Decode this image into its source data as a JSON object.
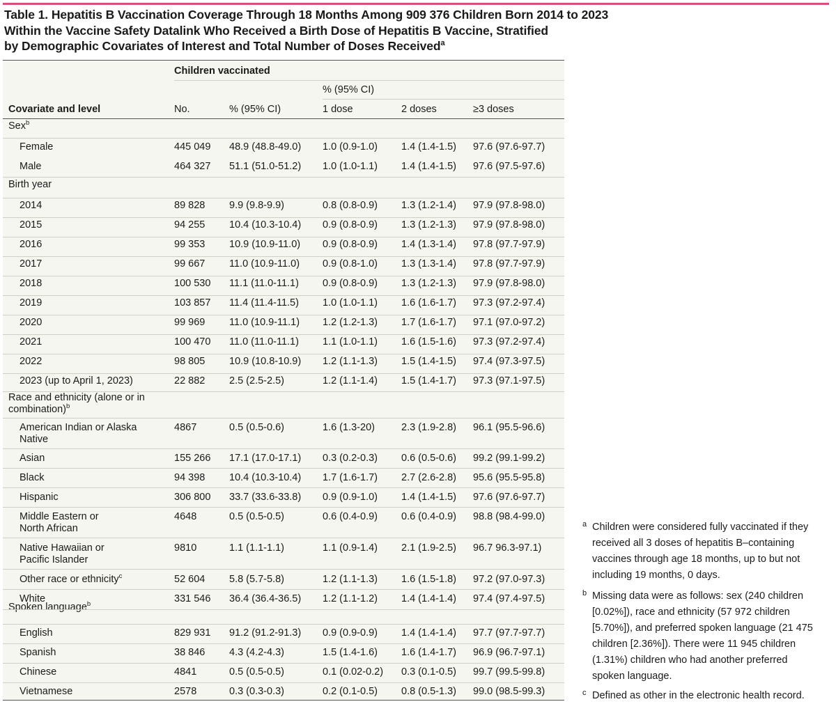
{
  "title": {
    "line1": "Table 1. Hepatitis B Vaccination Coverage Through 18 Months Among 909 376 Children Born 2014 to 2023",
    "line2": "Within the Vaccine Safety Datalink Who Received a Birth Dose of Hepatitis B Vaccine, Stratified",
    "line3": "by Demographic Covariates of Interest and Total Number of Doses Received",
    "line3_sup": "a"
  },
  "header": {
    "children_vaccinated": "Children vaccinated",
    "pct_ci_group": "% (95% CI)",
    "col_covariate": "Covariate and level",
    "col_no": "No.",
    "col_pct": "% (95% CI)",
    "col_1dose": "1 dose",
    "col_2doses": "2 doses",
    "col_3doses": "≥3 doses"
  },
  "sections": {
    "sex": {
      "label": "Sex",
      "sup": "b"
    },
    "birth_year": {
      "label": "Birth year"
    },
    "race": {
      "label1": "Race and ethnicity (alone or in",
      "label2": "combination)",
      "sup": "b"
    },
    "language": {
      "label": "Spoken language",
      "sup": "b"
    }
  },
  "rows": [
    {
      "label": "Female",
      "no": "445 049",
      "pct": "48.9 (48.8-49.0)",
      "d1": "1.0 (0.9-1.0)",
      "d2": "1.4 (1.4-1.5)",
      "d3": "97.6 (97.6-97.7)"
    },
    {
      "label": "Male",
      "no": "464 327",
      "pct": "51.1 (51.0-51.2)",
      "d1": "1.0 (1.0-1.1)",
      "d2": "1.4 (1.4-1.5)",
      "d3": "97.6 (97.5-97.6)"
    },
    {
      "label": "2014",
      "no": "89 828",
      "pct": "9.9 (9.8-9.9)",
      "d1": "0.8 (0.8-0.9)",
      "d2": "1.3 (1.2-1.4)",
      "d3": "97.9 (97.8-98.0)"
    },
    {
      "label": "2015",
      "no": "94 255",
      "pct": "10.4 (10.3-10.4)",
      "d1": "0.9 (0.8-0.9)",
      "d2": "1.3 (1.2-1.3)",
      "d3": "97.9 (97.8-98.0)"
    },
    {
      "label": "2016",
      "no": "99 353",
      "pct": "10.9 (10.9-11.0)",
      "d1": "0.9 (0.8-0.9)",
      "d2": "1.4 (1.3-1.4)",
      "d3": "97.8 (97.7-97.9)"
    },
    {
      "label": "2017",
      "no": "99 667",
      "pct": "11.0 (10.9-11.0)",
      "d1": "0.9 (0.8-1.0)",
      "d2": "1.3 (1.3-1.4)",
      "d3": "97.8 (97.7-97.9)"
    },
    {
      "label": "2018",
      "no": "100 530",
      "pct": "11.1 (11.0-11.1)",
      "d1": "0.9 (0.8-0.9)",
      "d2": "1.3 (1.2-1.3)",
      "d3": "97.9 (97.8-98.0)"
    },
    {
      "label": "2019",
      "no": "103 857",
      "pct": "11.4 (11.4-11.5)",
      "d1": "1.0 (1.0-1.1)",
      "d2": "1.6 (1.6-1.7)",
      "d3": "97.3 (97.2-97.4)"
    },
    {
      "label": "2020",
      "no": "99 969",
      "pct": "11.0 (10.9-11.1)",
      "d1": "1.2 (1.2-1.3)",
      "d2": "1.7 (1.6-1.7)",
      "d3": "97.1 (97.0-97.2)"
    },
    {
      "label": "2021",
      "no": "100 470",
      "pct": "11.0 (11.0-11.1)",
      "d1": "1.1 (1.0-1.1)",
      "d2": "1.6 (1.5-1.6)",
      "d3": "97.3 (97.2-97.4)"
    },
    {
      "label": "2022",
      "no": "98 805",
      "pct": "10.9 (10.8-10.9)",
      "d1": "1.2 (1.1-1.3)",
      "d2": "1.5 (1.4-1.5)",
      "d3": "97.4 (97.3-97.5)"
    },
    {
      "label": "2023 (up to April 1, 2023)",
      "no": "22 882",
      "pct": "2.5 (2.5-2.5)",
      "d1": "1.2 (1.1-1.4)",
      "d2": "1.5 (1.4-1.7)",
      "d3": "97.3 (97.1-97.5)"
    },
    {
      "label": "American Indian or Alaska",
      "label2": "Native",
      "no": "4867",
      "pct": "0.5 (0.5-0.6)",
      "d1": "1.6 (1.3-20)",
      "d2": "2.3 (1.9-2.8)",
      "d3": "96.1 (95.5-96.6)"
    },
    {
      "label": "Asian",
      "no": "155 266",
      "pct": "17.1 (17.0-17.1)",
      "d1": "0.3 (0.2-0.3)",
      "d2": "0.6 (0.5-0.6)",
      "d3": "99.2 (99.1-99.2)"
    },
    {
      "label": "Black",
      "no": "94 398",
      "pct": "10.4 (10.3-10.4)",
      "d1": "1.7 (1.6-1.7)",
      "d2": "2.7 (2.6-2.8)",
      "d3": "95.6 (95.5-95.8)"
    },
    {
      "label": "Hispanic",
      "no": "306 800",
      "pct": "33.7 (33.6-33.8)",
      "d1": "0.9 (0.9-1.0)",
      "d2": "1.4 (1.4-1.5)",
      "d3": "97.6 (97.6-97.7)"
    },
    {
      "label": "Middle Eastern or",
      "label2": "North African",
      "no": "4648",
      "pct": "0.5 (0.5-0.5)",
      "d1": "0.6 (0.4-0.9)",
      "d2": "0.6 (0.4-0.9)",
      "d3": "98.8 (98.4-99.0)"
    },
    {
      "label": "Native Hawaiian or",
      "label2": "Pacific Islander",
      "no": "9810",
      "pct": "1.1 (1.1-1.1)",
      "d1": "1.1 (0.9-1.4)",
      "d2": "2.1 (1.9-2.5)",
      "d3": "96.7 96.3-97.1)"
    },
    {
      "label": "Other race or ethnicity",
      "sup": "c",
      "no": "52 604",
      "pct": "5.8 (5.7-5.8)",
      "d1": "1.2 (1.1-1.3)",
      "d2": "1.6 (1.5-1.8)",
      "d3": "97.2 (97.0-97.3)"
    },
    {
      "label": "White",
      "no": "331 546",
      "pct": "36.4 (36.4-36.5)",
      "d1": "1.2 (1.1-1.2)",
      "d2": "1.4 (1.4-1.4)",
      "d3": "97.4 (97.4-97.5)"
    },
    {
      "label": "English",
      "no": "829 931",
      "pct": "91.2 (91.2-91.3)",
      "d1": "0.9 (0.9-0.9)",
      "d2": "1.4 (1.4-1.4)",
      "d3": "97.7 (97.7-97.7)"
    },
    {
      "label": "Spanish",
      "no": "38 846",
      "pct": "4.3 (4.2-4.3)",
      "d1": "1.5 (1.4-1.6)",
      "d2": "1.6 (1.4-1.7)",
      "d3": "96.9 (96.7-97.1)"
    },
    {
      "label": "Chinese",
      "no": "4841",
      "pct": "0.5 (0.5-0.5)",
      "d1": "0.1 (0.02-0.2)",
      "d2": "0.3 (0.1-0.5)",
      "d3": "99.7 (99.5-99.8)"
    },
    {
      "label": "Vietnamese",
      "no": "2578",
      "pct": "0.3 (0.3-0.3)",
      "d1": "0.2 (0.1-0.5)",
      "d2": "0.8 (0.5-1.3)",
      "d3": "99.0 (98.5-99.3)"
    }
  ],
  "footnotes": [
    {
      "mark": "a",
      "lines": [
        "Children were considered fully vaccinated if they",
        "received all 3 doses of hepatitis B–containing",
        "vaccines through age 18 months, up to but not",
        "including 19 months, 0 days."
      ]
    },
    {
      "mark": "b",
      "lines": [
        "Missing data were as follows: sex (240 children",
        "[0.02%]), race and ethnicity (57 972 children",
        "[5.70%]), and preferred spoken language (21 475",
        "children [2.36%]). There were 11 945 children",
        "(1.31%) children who had another preferred",
        "spoken language."
      ]
    },
    {
      "mark": "c",
      "lines": [
        "Defined as other in the electronic health record."
      ]
    }
  ]
}
